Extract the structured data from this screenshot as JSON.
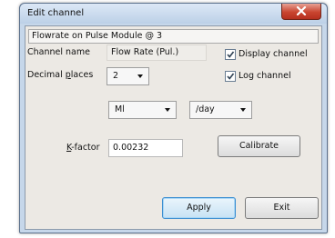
{
  "window": {
    "title": "Edit channel"
  },
  "header": {
    "text": "Flowrate on Pulse Module @ 3"
  },
  "channel_name": {
    "label": "Channel name",
    "value": "Flow Rate (Pul.)"
  },
  "decimal_places": {
    "label_pre": "Decimal ",
    "label_u": "p",
    "label_post": "laces",
    "value": "2"
  },
  "display_channel": {
    "label": "Display channel",
    "checked": true
  },
  "log_channel": {
    "label": "Log channel",
    "checked": true
  },
  "unit_combo": {
    "value": "Ml"
  },
  "rate_combo": {
    "value": "/day"
  },
  "kfactor": {
    "label_u": "K",
    "label_post": "-factor",
    "value": "0.00232"
  },
  "buttons": {
    "calibrate": "Calibrate",
    "apply": "Apply",
    "exit": "Exit"
  },
  "icons": {
    "close": "close-icon",
    "checkmark": "checkmark-icon",
    "dropdown": "chevron-down-icon"
  }
}
